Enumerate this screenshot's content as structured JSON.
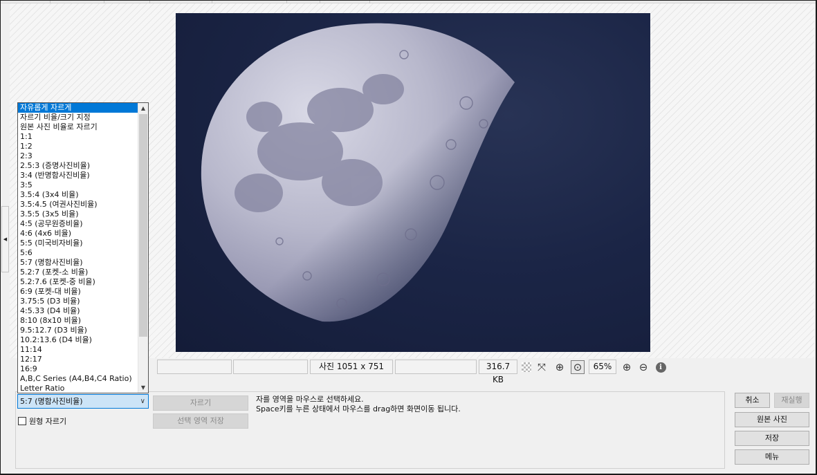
{
  "crop_list": {
    "items": [
      "자유롭게 자르게",
      "자르기 비율/크기 지정",
      "원본 사진 비율로 자르기",
      "1:1",
      "1:2",
      "2:3",
      "2.5:3 (증명사진비율)",
      "3:4 (반명함사진비율)",
      "3:5",
      "3.5:4 (3x4 비율)",
      "3.5:4.5 (여권사진비율)",
      "3.5:5 (3x5 비율)",
      "4:5 (공무원증비율)",
      "4:6 (4x6 비율)",
      "5:5 (미국비자비율)",
      "5:6",
      "5:7 (명함사진비율)",
      "5.2:7 (포켓-소 비율)",
      "5.2:7.6 (포켓-중 비율)",
      "6:9 (포켓-대 비율)",
      "3.75:5 (D3 비율)",
      "4:5.33 (D4 비율)",
      "8:10 (8x10 비율)",
      "9.5:12.7 (D3 비율)",
      "10.2:13.6 (D4 비율)",
      "11:14",
      "12:17",
      "16:9",
      "A,B,C Series (A4,B4,C4 Ratio)",
      "Letter Ratio"
    ],
    "selected_index": 0
  },
  "combo": {
    "value": "5:7 (명함사진비율)"
  },
  "circle_crop": {
    "label": "원형 자르기",
    "checked": false
  },
  "buttons": {
    "crop": "자르기",
    "save_selection": "선택 영역 저장",
    "cancel": "취소",
    "redo": "재실행",
    "original_photo": "원본 사진",
    "save": "저장",
    "menu": "메뉴"
  },
  "hint": {
    "line1": "자를 영역을 마우스로 선택하세요.",
    "line2": "Space키를 누른 상태에서 마우스를 drag하면 화면이동 됩니다."
  },
  "status": {
    "photo_size": "사진 1051 x 751",
    "file_size": "316.7 KB",
    "zoom": "65%"
  },
  "icons": {
    "transparency": "checkerboard-icon",
    "fit": "fit-to-window-icon",
    "actual": "actual-size-icon",
    "fit_screen": "fit-screen-icon",
    "zoom_in": "zoom-in-icon",
    "zoom_out": "zoom-out-icon",
    "info": "info-icon"
  },
  "colors": {
    "selection": "#0078d7",
    "combo_bg": "#cce4f7",
    "sky": "#1b2546"
  }
}
